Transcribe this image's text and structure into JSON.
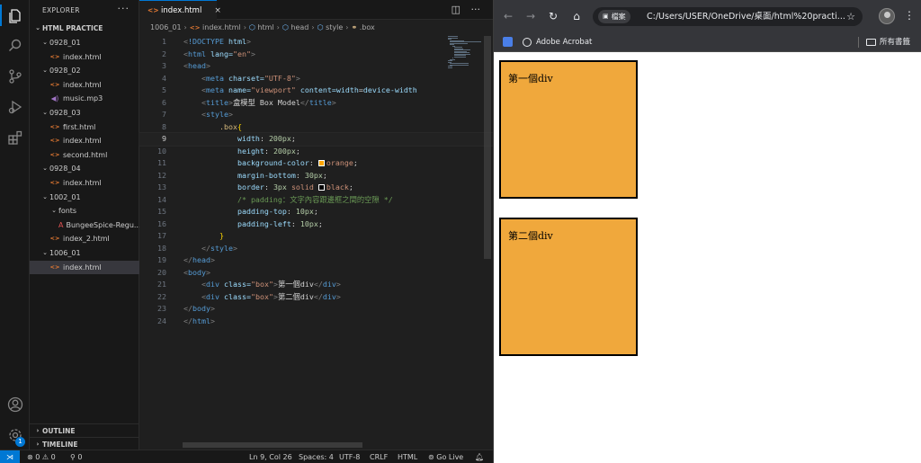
{
  "explorer": {
    "header": "EXPLORER",
    "more": "···",
    "root": "HTML PRACTICE",
    "tree": [
      {
        "label": "0928_01",
        "type": "folder",
        "depth": 1
      },
      {
        "label": "index.html",
        "type": "html",
        "depth": 2
      },
      {
        "label": "0928_02",
        "type": "folder",
        "depth": 1
      },
      {
        "label": "index.html",
        "type": "html",
        "depth": 2
      },
      {
        "label": "music.mp3",
        "type": "mp3",
        "depth": 2
      },
      {
        "label": "0928_03",
        "type": "folder",
        "depth": 1
      },
      {
        "label": "first.html",
        "type": "html",
        "depth": 2
      },
      {
        "label": "index.html",
        "type": "html",
        "depth": 2
      },
      {
        "label": "second.html",
        "type": "html",
        "depth": 2
      },
      {
        "label": "0928_04",
        "type": "folder",
        "depth": 1
      },
      {
        "label": "index.html",
        "type": "html",
        "depth": 2
      },
      {
        "label": "1002_01",
        "type": "folder",
        "depth": 1
      },
      {
        "label": "fonts",
        "type": "folder",
        "depth": 2
      },
      {
        "label": "BungeeSpice-Regu...",
        "type": "font",
        "depth": 3
      },
      {
        "label": "index_2.html",
        "type": "html",
        "depth": 2
      },
      {
        "label": "1006_01",
        "type": "folder",
        "depth": 1
      },
      {
        "label": "index.html",
        "type": "html",
        "depth": 2,
        "selected": true
      }
    ],
    "outline": "OUTLINE",
    "timeline": "TIMELINE"
  },
  "editor": {
    "tab_label": "index.html",
    "tab_close": "×",
    "breadcrumb": {
      "folder": "1006_01",
      "file": "index.html",
      "b1": "html",
      "b2": "head",
      "b3": "style",
      "b4": ".box"
    },
    "current_line": 9,
    "code": [
      "<!DOCTYPE html>",
      "<html lang=\"en\">",
      "<head>",
      "    <meta charset=\"UTF-8\">",
      "    <meta name=\"viewport\" content=\"width=device-width",
      "    <title>盒模型 Box Model</title>",
      "    <style>",
      "        .box{",
      "            width: 200px;",
      "            height: 200px;",
      "            background-color: orange;",
      "            margin-bottom: 30px;",
      "            border: 3px solid black;",
      "            /* padding：文字內容跟邊框之間的空隙 */",
      "            padding-top: 10px;",
      "            padding-left: 10px;",
      "        }",
      "    </style>",
      "</head>",
      "<body>",
      "    <div class=\"box\">第一個div</div>",
      "    <div class=\"box\">第二個div</div>",
      "</body>",
      "</html>"
    ]
  },
  "statusbar": {
    "errors": "⊗ 0  ⚠ 0",
    "ports": "⚲ 0",
    "position": "Ln 9, Col 26",
    "spaces": "Spaces: 4",
    "encoding": "UTF-8",
    "eol": "CRLF",
    "language": "HTML",
    "golive": "⊚ Go Live",
    "bell": "🔔︎"
  },
  "browser": {
    "chip_label": "檔案",
    "url": "C:/Users/USER/OneDrive/桌面/html%20practi...",
    "bookmark_1": "Adobe Acrobat",
    "all_bookmarks": "所有書籤",
    "boxes": [
      {
        "text": "第一個div"
      },
      {
        "text": "第二個div"
      }
    ]
  },
  "colors": {
    "accent": "#0078d4",
    "box_fill": "#f0a83c",
    "box_border": "#000000"
  }
}
